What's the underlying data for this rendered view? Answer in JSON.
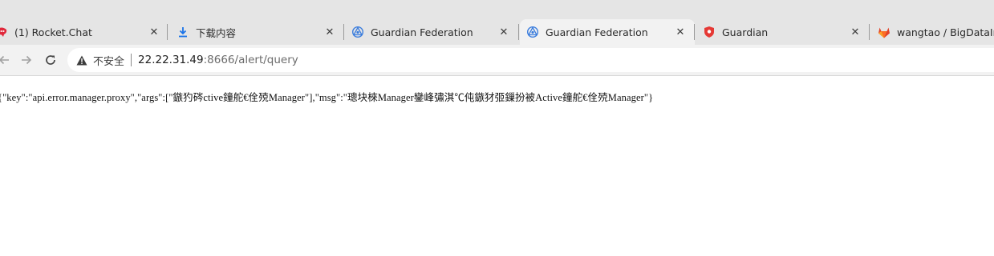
{
  "tabs": [
    {
      "title": "(1) Rocket.Chat",
      "icon": "rocket-chat-icon",
      "active": false
    },
    {
      "title": "下载内容",
      "icon": "download-icon",
      "active": false
    },
    {
      "title": "Guardian Federation",
      "icon": "guardian-federation-icon",
      "active": false
    },
    {
      "title": "Guardian Federation",
      "icon": "guardian-federation-icon",
      "active": true
    },
    {
      "title": "Guardian",
      "icon": "guardian-shield-icon",
      "active": false
    },
    {
      "title": "wangtao / BigDataInfo",
      "icon": "gitlab-icon",
      "active": false
    }
  ],
  "tab_close_label": "✕",
  "address_bar": {
    "security_label": "不安全",
    "url_host": "22.22.31.49",
    "url_rest": ":8666/alert/query"
  },
  "page": {
    "body_text": "{\"key\":\"api.error.manager.proxy\",\"args\":[\"鏃犳硶ctive鐘舵€佺殑Manager\"],\"msg\":\"璁块棶Manager鑾峰彇淇℃伅鏃犲弬鏁扮被Active鐘舵€佺殑Manager\"}"
  },
  "colors": {
    "tabstrip_bg": "#e5e5e5",
    "toolbar_bg": "#f2f2f2",
    "gitlab_orange": "#e24329",
    "guardian_blue": "#3b7ddd",
    "guardian_red": "#e53935",
    "rocket_red": "#e0283b"
  }
}
